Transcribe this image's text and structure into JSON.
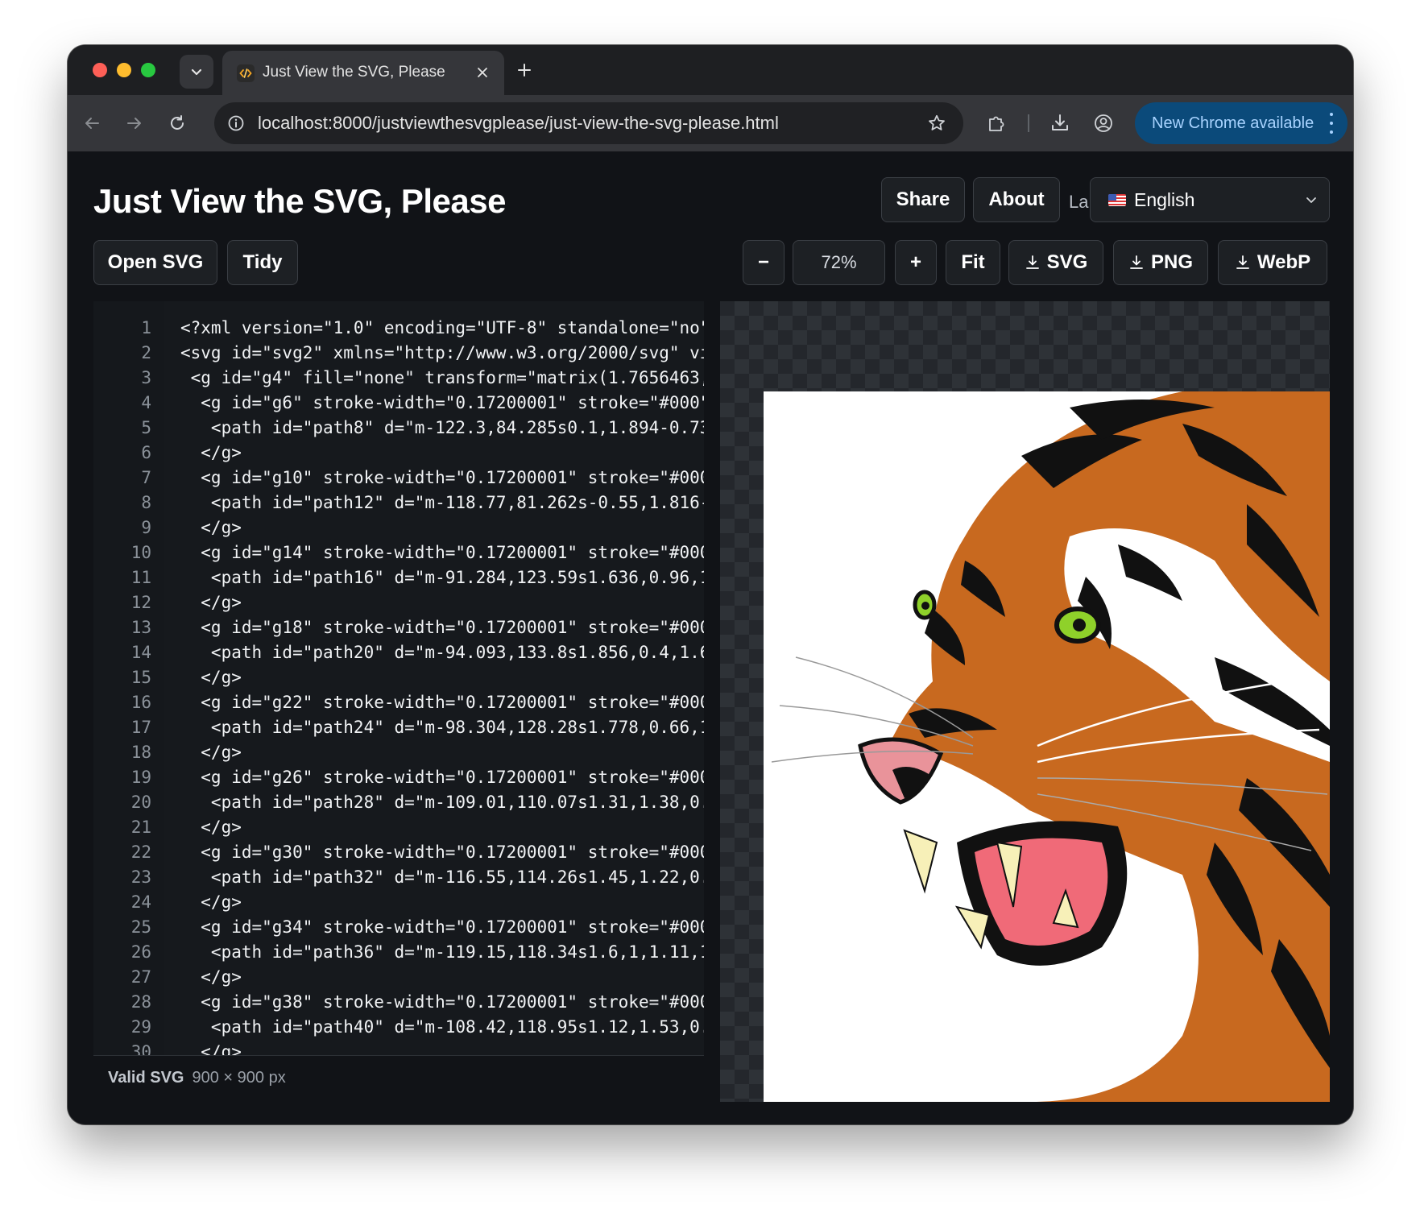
{
  "browser": {
    "tab_title": "Just View the SVG, Please",
    "url": "localhost:8000/justviewthesvgplease/just-view-the-svg-please.html",
    "update_label": "New Chrome available"
  },
  "app": {
    "title": "Just View the SVG, Please",
    "share_label": "Share",
    "about_label": "About",
    "language_label": "Language",
    "language_value": "English"
  },
  "toolbar": {
    "open_label": "Open SVG",
    "tidy_label": "Tidy",
    "zoom_out_label": "−",
    "zoom_value": "72%",
    "zoom_in_label": "+",
    "fit_label": "Fit",
    "svg_label": "SVG",
    "png_label": "PNG",
    "webp_label": "WebP"
  },
  "editor": {
    "lines": [
      {
        "n": "1",
        "code": "<?xml version=\"1.0\" encoding=\"UTF-8\" standalone=\"no\""
      },
      {
        "n": "2",
        "code": "<svg id=\"svg2\" xmlns=\"http://www.w3.org/2000/svg\" vi"
      },
      {
        "n": "3",
        "code": " <g id=\"g4\" fill=\"none\" transform=\"matrix(1.7656463,"
      },
      {
        "n": "4",
        "code": "  <g id=\"g6\" stroke-width=\"0.17200001\" stroke=\"#000\""
      },
      {
        "n": "5",
        "code": "   <path id=\"path8\" d=\"m-122.3,84.285s0.1,1.894-0.73"
      },
      {
        "n": "6",
        "code": "  </g>"
      },
      {
        "n": "7",
        "code": "  <g id=\"g10\" stroke-width=\"0.17200001\" stroke=\"#000"
      },
      {
        "n": "8",
        "code": "   <path id=\"path12\" d=\"m-118.77,81.262s-0.55,1.816-"
      },
      {
        "n": "9",
        "code": "  </g>"
      },
      {
        "n": "10",
        "code": "  <g id=\"g14\" stroke-width=\"0.17200001\" stroke=\"#000"
      },
      {
        "n": "11",
        "code": "   <path id=\"path16\" d=\"m-91.284,123.59s1.636,0.96,1"
      },
      {
        "n": "12",
        "code": "  </g>"
      },
      {
        "n": "13",
        "code": "  <g id=\"g18\" stroke-width=\"0.17200001\" stroke=\"#000"
      },
      {
        "n": "14",
        "code": "   <path id=\"path20\" d=\"m-94.093,133.8s1.856,0.4,1.6"
      },
      {
        "n": "15",
        "code": "  </g>"
      },
      {
        "n": "16",
        "code": "  <g id=\"g22\" stroke-width=\"0.17200001\" stroke=\"#000"
      },
      {
        "n": "17",
        "code": "   <path id=\"path24\" d=\"m-98.304,128.28s1.778,0.66,1"
      },
      {
        "n": "18",
        "code": "  </g>"
      },
      {
        "n": "19",
        "code": "  <g id=\"g26\" stroke-width=\"0.17200001\" stroke=\"#000"
      },
      {
        "n": "20",
        "code": "   <path id=\"path28\" d=\"m-109.01,110.07s1.31,1.38,0."
      },
      {
        "n": "21",
        "code": "  </g>"
      },
      {
        "n": "22",
        "code": "  <g id=\"g30\" stroke-width=\"0.17200001\" stroke=\"#000"
      },
      {
        "n": "23",
        "code": "   <path id=\"path32\" d=\"m-116.55,114.26s1.45,1.22,0."
      },
      {
        "n": "24",
        "code": "  </g>"
      },
      {
        "n": "25",
        "code": "  <g id=\"g34\" stroke-width=\"0.17200001\" stroke=\"#000"
      },
      {
        "n": "26",
        "code": "   <path id=\"path36\" d=\"m-119.15,118.34s1.6,1,1.11,1"
      },
      {
        "n": "27",
        "code": "  </g>"
      },
      {
        "n": "28",
        "code": "  <g id=\"g38\" stroke-width=\"0.17200001\" stroke=\"#000"
      },
      {
        "n": "29",
        "code": "   <path id=\"path40\" d=\"m-108.42,118.95s1.12,1.53,0."
      },
      {
        "n": "30",
        "code": "  </g>"
      }
    ]
  },
  "status": {
    "valid_label": "Valid SVG",
    "dimensions": "900 × 900 px"
  },
  "colors": {
    "page_bg": "#111317",
    "button_bg": "#1d2024",
    "button_border": "#3a3e44",
    "update_pill": "#0b4a7a",
    "tiger_orange": "#c8691f",
    "tiger_eye": "#8fd12a",
    "tiger_mouth": "#f06a78"
  }
}
